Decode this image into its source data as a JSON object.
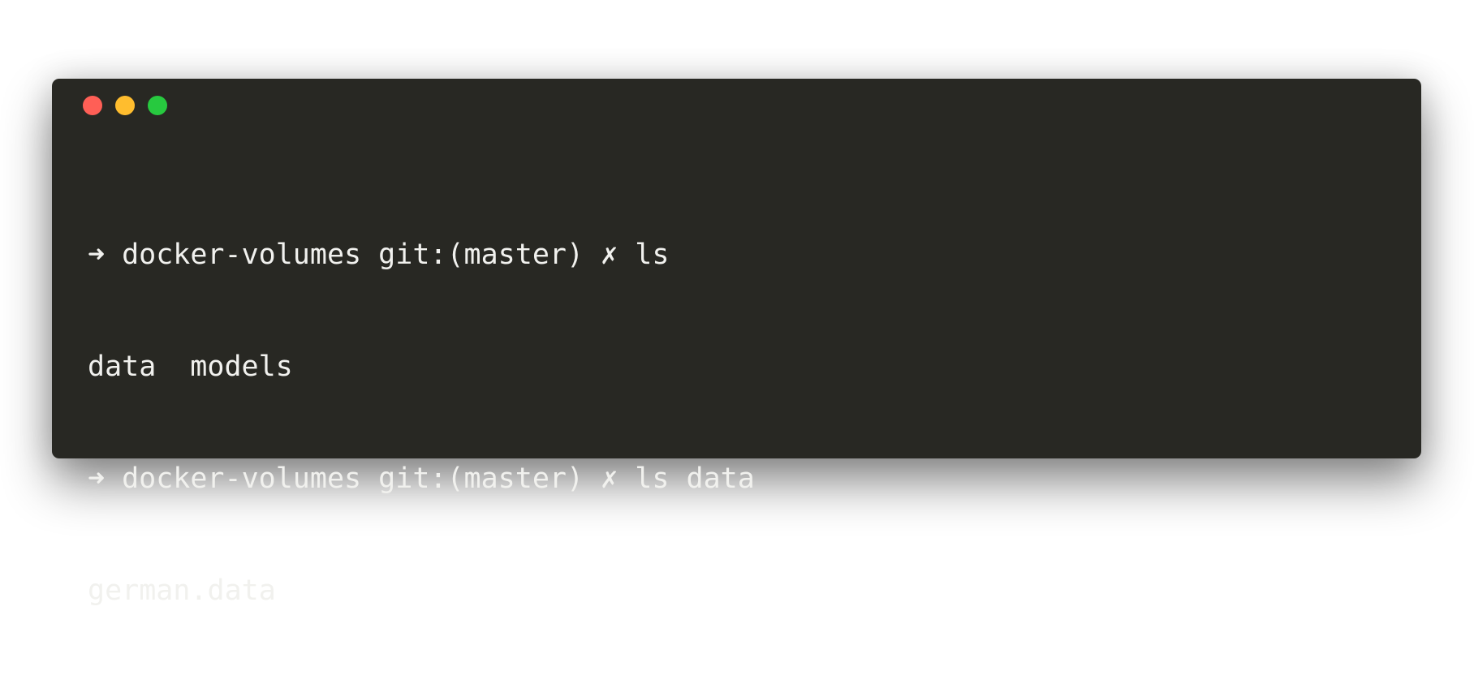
{
  "window": {
    "traffic_lights": {
      "close_color": "#ff5f56",
      "minimize_color": "#ffbd2e",
      "zoom_color": "#27c93f"
    }
  },
  "terminal": {
    "lines": [
      {
        "kind": "prompt",
        "arrow": "➜",
        "directory": "docker-volumes",
        "git": "git:(master)",
        "dirty": "✗",
        "command": "ls"
      },
      {
        "kind": "output",
        "items": [
          "data",
          "models"
        ]
      },
      {
        "kind": "prompt",
        "arrow": "➜",
        "directory": "docker-volumes",
        "git": "git:(master)",
        "dirty": "✗",
        "command": "ls data"
      },
      {
        "kind": "output",
        "items": [
          "german.data"
        ]
      }
    ]
  }
}
